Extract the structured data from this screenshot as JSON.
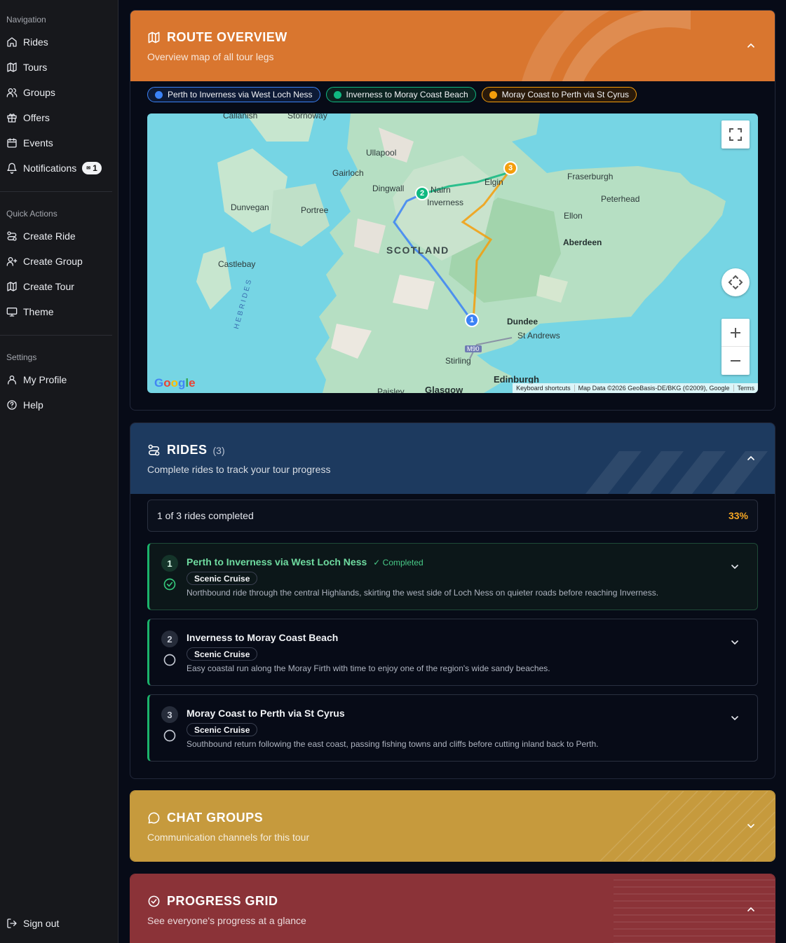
{
  "sidebar": {
    "sections": [
      {
        "heading": "Navigation",
        "items": [
          {
            "label": "Rides",
            "icon": "home-icon"
          },
          {
            "label": "Tours",
            "icon": "map-icon"
          },
          {
            "label": "Groups",
            "icon": "users-icon"
          },
          {
            "label": "Offers",
            "icon": "gift-icon"
          },
          {
            "label": "Events",
            "icon": "calendar-icon"
          },
          {
            "label": "Notifications",
            "icon": "bell-icon",
            "badge": "1"
          }
        ]
      },
      {
        "heading": "Quick Actions",
        "items": [
          {
            "label": "Create Ride",
            "icon": "route-icon"
          },
          {
            "label": "Create Group",
            "icon": "user-plus-icon"
          },
          {
            "label": "Create Tour",
            "icon": "map-icon"
          },
          {
            "label": "Theme",
            "icon": "monitor-icon"
          }
        ]
      },
      {
        "heading": "Settings",
        "items": [
          {
            "label": "My Profile",
            "icon": "user-icon"
          },
          {
            "label": "Help",
            "icon": "help-circle-icon"
          }
        ]
      }
    ],
    "sign_out": "Sign out"
  },
  "route_overview": {
    "title": "ROUTE OVERVIEW",
    "subtitle": "Overview map of all tour legs",
    "accent": "#d9762f",
    "legend": [
      {
        "label": "Perth to Inverness via West Loch Ness",
        "color": "#3b82f6"
      },
      {
        "label": "Inverness to Moray Coast Beach",
        "color": "#10b981"
      },
      {
        "label": "Moray Coast to Perth via St Cyrus",
        "color": "#f59e0b"
      }
    ],
    "map": {
      "labels": [
        "Callanish",
        "Stornoway",
        "Ullapool",
        "Gairloch",
        "Dingwall",
        "Nairn",
        "Elgin",
        "Inverness",
        "Fraserburgh",
        "Peterhead",
        "Dunvegan",
        "Portree",
        "Ellon",
        "SCOTLAND",
        "Aberdeen",
        "Castlebay",
        "HEBRIDES",
        "Dundee",
        "St Andrews",
        "M90",
        "Stirling",
        "Edinburgh",
        "Paisley",
        "Glasgow"
      ],
      "markers": [
        "1",
        "2",
        "3"
      ],
      "footer": [
        "Keyboard shortcuts",
        "Map Data ©2026 GeoBasis-DE/BKG (©2009), Google",
        "Terms"
      ],
      "logo": "Google"
    }
  },
  "rides": {
    "title": "RIDES",
    "count": "(3)",
    "subtitle": "Complete rides to track your tour progress",
    "accent": "#1d3a5f",
    "progress_text": "1 of 3 rides completed",
    "progress_pct": "33%",
    "progress_fraction": 0.33,
    "items": [
      {
        "num": "1",
        "title": "Perth to Inverness via West Loch Ness",
        "status": "✓ Completed",
        "tag": "Scenic Cruise",
        "desc": "Northbound ride through the central Highlands, skirting the west side of Loch Ness on quieter roads before reaching Inverness.",
        "done": true
      },
      {
        "num": "2",
        "title": "Inverness to Moray Coast Beach",
        "status": "",
        "tag": "Scenic Cruise",
        "desc": "Easy coastal run along the Moray Firth with time to enjoy one of the region's wide sandy beaches.",
        "done": false
      },
      {
        "num": "3",
        "title": "Moray Coast to Perth via St Cyrus",
        "status": "",
        "tag": "Scenic Cruise",
        "desc": "Southbound return following the east coast, passing fishing towns and cliffs before cutting inland back to Perth.",
        "done": false
      }
    ]
  },
  "chat_groups": {
    "title": "CHAT GROUPS",
    "subtitle": "Communication channels for this tour",
    "accent": "#c69a3d"
  },
  "progress_grid": {
    "title": "PROGRESS GRID",
    "subtitle": "See everyone's progress at a glance",
    "accent": "#8b3338"
  }
}
